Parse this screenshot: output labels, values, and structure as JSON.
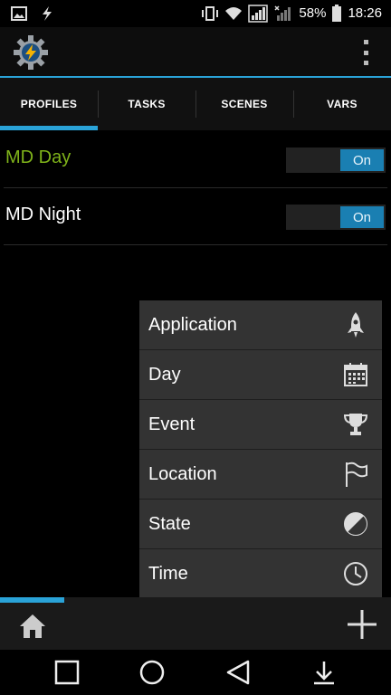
{
  "status_bar": {
    "battery_percent": "58%",
    "time": "18:26",
    "icons": [
      "image-icon",
      "bolt-icon",
      "vibrate-icon",
      "wifi-icon",
      "signal-r-icon",
      "signal-x-icon",
      "battery-icon"
    ]
  },
  "app_bar": {
    "logo": "tasker-gear-bolt-icon",
    "menu": "overflow-menu-icon"
  },
  "tabs": [
    {
      "label": "PROFILES",
      "active": true
    },
    {
      "label": "TASKS",
      "active": false
    },
    {
      "label": "SCENES",
      "active": false
    },
    {
      "label": "VARS",
      "active": false
    }
  ],
  "profiles": [
    {
      "name": "MD Day",
      "toggle": "On",
      "color": "#7fb31a"
    },
    {
      "name": "MD Night",
      "toggle": "On",
      "color": "#ffffff"
    }
  ],
  "popup_menu": {
    "items": [
      {
        "label": "Application",
        "icon": "rocket-icon"
      },
      {
        "label": "Day",
        "icon": "calendar-icon"
      },
      {
        "label": "Event",
        "icon": "trophy-icon"
      },
      {
        "label": "Location",
        "icon": "flag-icon"
      },
      {
        "label": "State",
        "icon": "half-circle-icon"
      },
      {
        "label": "Time",
        "icon": "clock-icon"
      }
    ]
  },
  "bottom_bar": {
    "progress_fraction": 0.165,
    "home": "home-icon",
    "add": "plus-icon"
  },
  "colors": {
    "accent": "#2aa3d8",
    "toggle_on": "#1a7fb2",
    "popup_bg": "#333333"
  }
}
